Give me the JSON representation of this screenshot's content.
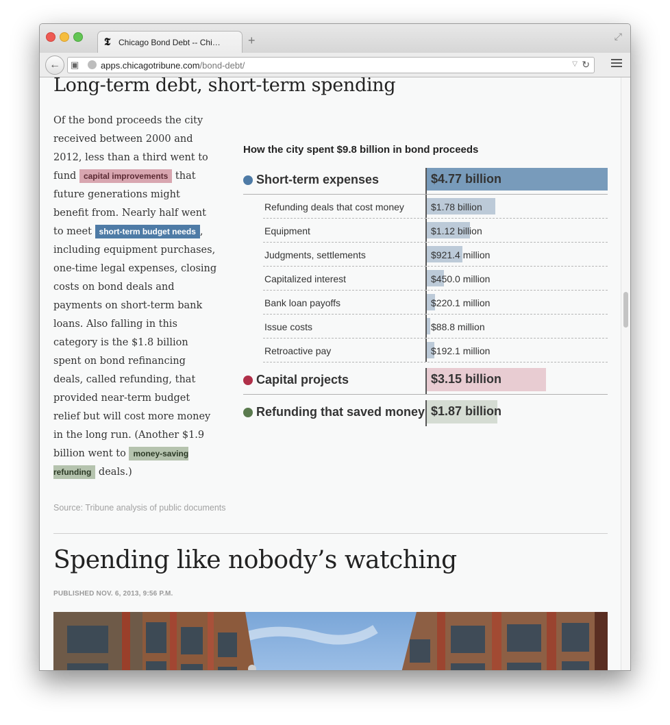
{
  "browser": {
    "tab_title": "Chicago Bond Debt -- Chi…",
    "tab_logo": "𝕿",
    "new_tab": "+",
    "url_host": "apps.chicagotribune.com",
    "url_path": "/bond-debt/"
  },
  "section": {
    "title": "Long-term debt, short-term spending",
    "lede": {
      "p1": "Of the bond proceeds the city received between 2000 and 2012, less than a third went to fund ",
      "hl1": "capital improvements",
      "p2": " that future generations might benefit from. Nearly half went to meet ",
      "hl2": "short-term budget needs",
      "p3": ", including equipment purchases, one-time legal expenses, closing costs on bond deals and payments on short-term bank loans. Also falling in this category is the $1.8 billion spent on bond refinancing deals, called refunding, that provided near-term budget relief but will cost more money in the long run. (Another $1.9 billion went to ",
      "hl3": "money-saving refunding",
      "p4": " deals.)"
    },
    "source": "Source: Tribune analysis of public documents"
  },
  "chart_data": {
    "type": "bar",
    "title": "How the city spent $9.8 billion in bond proceeds",
    "unit": "millions of dollars",
    "series": [
      {
        "name": "Short-term expenses",
        "label": "$4.77 billion",
        "value": 4770,
        "color": "#4e7ba6",
        "items": [
          {
            "name": "Refunding deals that cost money",
            "label": "$1.78 billion",
            "value": 1780
          },
          {
            "name": "Equipment",
            "label": "$1.12 billion",
            "value": 1120
          },
          {
            "name": "Judgments, settlements",
            "label": "$921.4 million",
            "value": 921.4
          },
          {
            "name": "Capitalized interest",
            "label": "$450.0 million",
            "value": 450.0
          },
          {
            "name": "Bank loan payoffs",
            "label": "$220.1 million",
            "value": 220.1
          },
          {
            "name": "Issue costs",
            "label": "$88.8 million",
            "value": 88.8
          },
          {
            "name": "Retroactive pay",
            "label": "$192.1 million",
            "value": 192.1
          }
        ]
      },
      {
        "name": "Capital projects",
        "label": "$3.15 billion",
        "value": 3150,
        "color": "#b03049"
      },
      {
        "name": "Refunding that saved money",
        "label": "$1.87 billion",
        "value": 1870,
        "color": "#5a7a4e"
      }
    ]
  },
  "article": {
    "headline": "Spending like nobody’s watching",
    "published": "PUBLISHED NOV. 6, 2013, 9:56 P.M."
  }
}
